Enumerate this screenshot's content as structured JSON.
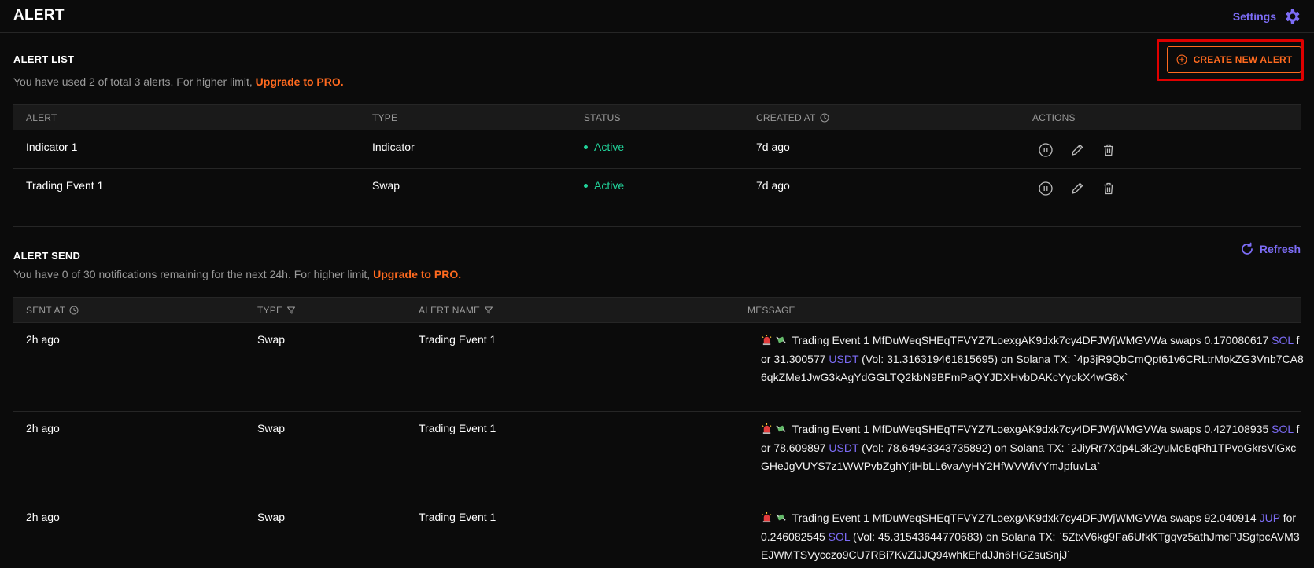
{
  "header": {
    "title": "ALERT",
    "settings_label": "Settings"
  },
  "colors": {
    "accent_purple": "#7c6cf5",
    "accent_orange": "#ff6a1f",
    "status_green": "#21d39a",
    "highlight_red": "#e00000",
    "background": "#0b0b0b"
  },
  "alert_list": {
    "title": "ALERT LIST",
    "usage_text": "You have used 2 of total 3 alerts. For higher limit,",
    "upgrade_label": "Upgrade to PRO.",
    "create_label": "CREATE NEW ALERT",
    "columns": {
      "alert": "ALERT",
      "type": "TYPE",
      "status": "STATUS",
      "created_at": "CREATED AT",
      "actions": "ACTIONS"
    },
    "rows": [
      {
        "alert": "Indicator 1",
        "type": "Indicator",
        "status": "Active",
        "created_at": "7d ago"
      },
      {
        "alert": "Trading Event 1",
        "type": "Swap",
        "status": "Active",
        "created_at": "7d ago"
      }
    ],
    "action_icons": [
      "pause-icon",
      "edit-icon",
      "trash-icon"
    ]
  },
  "alert_send": {
    "title": "ALERT SEND",
    "usage_text": "You have 0 of 30 notifications remaining for the next 24h. For higher limit,",
    "upgrade_label": "Upgrade to PRO.",
    "refresh_label": "Refresh",
    "columns": {
      "sent_at": "SENT AT",
      "type": "TYPE",
      "alert_name": "ALERT NAME",
      "message": "MESSAGE"
    },
    "rows": [
      {
        "sent_at": "2h ago",
        "type": "Swap",
        "alert_name": "Trading Event 1",
        "msg_a": "Trading Event 1 MfDuWeqSHEqTFVYZ7LoexgAK9dxk7cy4DFJWjWMGVWa swaps 0.170080617",
        "tok1": "SOL",
        "msg_b": "for 31.300577",
        "tok2": "USDT",
        "msg_c": "(Vol: 31.316319461815695) on Solana TX: `4p3jR9QbCmQpt61v6CRLtrMokZG3Vnb7CA86qkZMe1JwG3kAgYdGGLTQ2kbN9BFmPaQYJDXHvbDAKcYyokX4wG8x`"
      },
      {
        "sent_at": "2h ago",
        "type": "Swap",
        "alert_name": "Trading Event 1",
        "msg_a": "Trading Event 1 MfDuWeqSHEqTFVYZ7LoexgAK9dxk7cy4DFJWjWMGVWa swaps 0.427108935",
        "tok1": "SOL",
        "msg_b": "for 78.609897",
        "tok2": "USDT",
        "msg_c": "(Vol: 78.64943343735892) on Solana TX: `2JiyRr7Xdp4L3k2yuMcBqRh1TPvoGkrsViGxcGHeJgVUYS7z1WWPvbZghYjtHbLL6vaAyHY2HfWVWiVYmJpfuvLa`"
      },
      {
        "sent_at": "2h ago",
        "type": "Swap",
        "alert_name": "Trading Event 1",
        "msg_a": "Trading Event 1 MfDuWeqSHEqTFVYZ7LoexgAK9dxk7cy4DFJWjWMGVWa swaps 92.040914",
        "tok1": "JUP",
        "msg_b": "for 0.246082545",
        "tok2": "SOL",
        "msg_c": "(Vol: 45.31543644770683) on Solana TX: `5ZtxV6kg9Fa6UfkKTgqvz5athJmcPJSgfpcAVM3EJWMTSVycczo9CU7RBi7KvZiJJQ94whkEhdJJn6HGZsuSnjJ`"
      }
    ]
  }
}
